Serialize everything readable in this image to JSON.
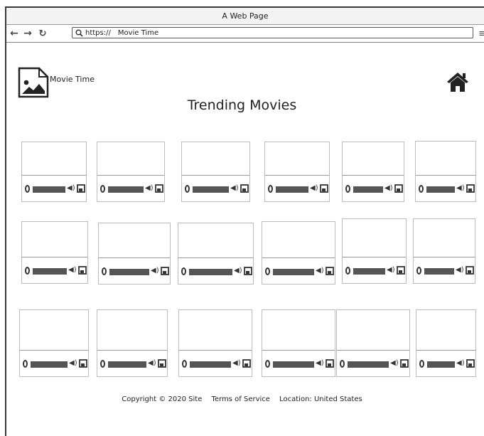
{
  "window": {
    "title": "A Web Page"
  },
  "browser": {
    "url_protocol": "https://",
    "url_text": "Movie Time"
  },
  "site": {
    "name": "Movie Time",
    "title": "Trending Movies"
  },
  "player": {
    "volume_icon": "speaker-icon",
    "fullscreen_icon": "fullscreen-icon",
    "play_icon": "play-icon"
  },
  "videos": {
    "rows": 3,
    "per_row": 6,
    "count": 18
  },
  "footer": {
    "copyright": "Copyright © 2020 Site",
    "terms": "Terms of Service",
    "location": "Location: United States"
  },
  "colors": {
    "border": "#3a3a3a",
    "card_border": "#bbbbbb",
    "track": "#555555"
  }
}
